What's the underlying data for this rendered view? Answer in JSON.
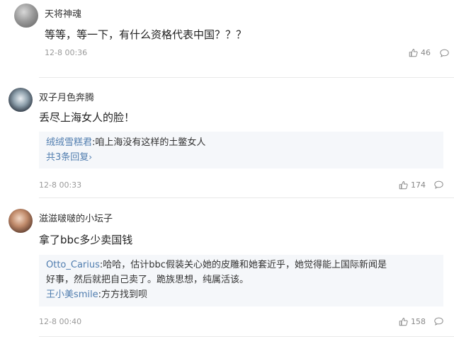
{
  "comments": [
    {
      "username": "天将神魂",
      "text": "等等，等一下，有什么资格代表中国？？？",
      "time": "12-8 00:36",
      "likes": "46",
      "avatar_icon": "avatar-icon"
    },
    {
      "username": "双子月色奔腾",
      "text": "丢尽上海女人的脸！",
      "replies": [
        {
          "user": "绒绒雪糕君",
          "text": ":咱上海没有这样的土鳖女人"
        }
      ],
      "more_replies": "共3条回复",
      "time": "12-8 00:33",
      "likes": "174",
      "avatar_icon": "avatar-icon"
    },
    {
      "username": "滋滋啵啵的小坛子",
      "text": "拿了bbc多少卖国钱",
      "replies": [
        {
          "user": "Otto_Carius",
          "text": ":哈哈，估计bbc假装关心她的皮雕和她套近乎，她觉得能上国际新闻是",
          "text2": "好事，然后就把自己卖了。跪族思想，纯属活该。"
        },
        {
          "user": "王小美smile",
          "text": ":方方找到呗"
        }
      ],
      "time": "12-8 00:40",
      "likes": "158",
      "avatar_icon": "avatar-icon"
    }
  ],
  "icons": {
    "like": "thumbs-up-icon",
    "comment": "comment-bubble-icon"
  },
  "colors": {
    "link": "#507daf",
    "reply_bg": "#f5f7fa",
    "meta": "#9a9a9a"
  }
}
